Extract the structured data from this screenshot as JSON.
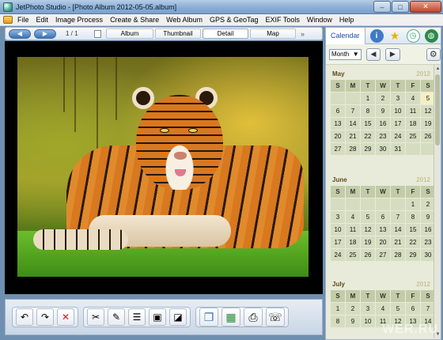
{
  "window": {
    "title": "JetPhoto Studio - [Photo Album 2012-05-05.album]",
    "min": "–",
    "max": "□",
    "close": "✕"
  },
  "menu": [
    "File",
    "Edit",
    "Image Process",
    "Create & Share",
    "Web Album",
    "GPS & GeoTag",
    "EXIF Tools",
    "Window",
    "Help"
  ],
  "nav": {
    "prev": "◀",
    "next": "▶",
    "counter": "1 / 1",
    "tabs": [
      "Album",
      "Thumbnail",
      "Detail",
      "Map"
    ],
    "more": "»"
  },
  "photo": {
    "subject": "tiger"
  },
  "toolbar": {
    "groups": [
      [
        "undo-icon",
        "redo-icon",
        "delete-icon"
      ],
      [
        "cut-icon",
        "edit-icon",
        "adjust-icon",
        "image-icon",
        "enhance-icon"
      ],
      [
        "slideshow-icon",
        "wallpaper-icon",
        "print-icon",
        "phone-icon"
      ]
    ]
  },
  "panel": {
    "tab_label": "Calendar",
    "mode_value": "Month",
    "mode_arrow": "▼",
    "prev": "◀",
    "next": "▶",
    "gear": "⚙"
  },
  "calendar": {
    "weekdays": [
      "S",
      "M",
      "T",
      "W",
      "T",
      "F",
      "S"
    ],
    "months": [
      {
        "name": "May",
        "year": "2012",
        "days": [
          "",
          "",
          "1",
          "2",
          "3",
          "4",
          "5",
          "6",
          "7",
          "8",
          "9",
          "10",
          "11",
          "12",
          "13",
          "14",
          "15",
          "16",
          "17",
          "18",
          "19",
          "20",
          "21",
          "22",
          "23",
          "24",
          "25",
          "26",
          "27",
          "28",
          "29",
          "30",
          "31",
          "",
          ""
        ],
        "highlight": "5"
      },
      {
        "name": "June",
        "year": "2012",
        "days": [
          "",
          "",
          "",
          "",
          "",
          "1",
          "2",
          "3",
          "4",
          "5",
          "6",
          "7",
          "8",
          "9",
          "10",
          "11",
          "12",
          "13",
          "14",
          "15",
          "16",
          "17",
          "18",
          "19",
          "20",
          "21",
          "22",
          "23",
          "24",
          "25",
          "26",
          "27",
          "28",
          "29",
          "30"
        ]
      },
      {
        "name": "July",
        "year": "2012",
        "days": [
          "1",
          "2",
          "3",
          "4",
          "5",
          "6",
          "7",
          "8",
          "9",
          "10",
          "11",
          "12",
          "13",
          "14"
        ]
      }
    ]
  },
  "watermark": "WER.RU"
}
